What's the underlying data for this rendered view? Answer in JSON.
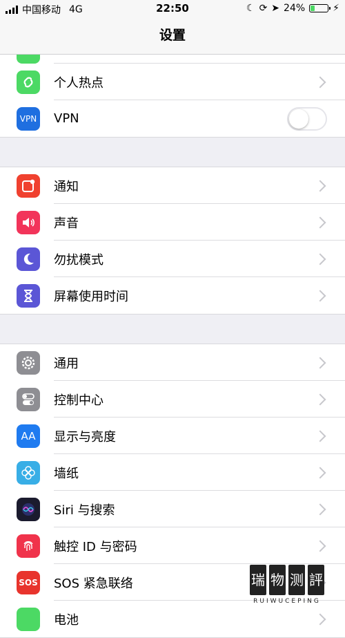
{
  "status": {
    "carrier": "中国移动",
    "network": "4G",
    "time": "22:50",
    "battery": "24%",
    "battery_level": 0.24
  },
  "nav": {
    "title": "设置"
  },
  "groups": [
    {
      "items": [
        {
          "label": "个人热点",
          "icon": "hotspot-icon",
          "color": "#4cd964"
        },
        {
          "label": "VPN",
          "icon": "vpn-icon",
          "color": "#1f6fe0",
          "toggle": false,
          "icon_text": "VPN"
        }
      ]
    },
    {
      "items": [
        {
          "label": "通知",
          "icon": "notifications-icon",
          "color": "#f0412f"
        },
        {
          "label": "声音",
          "icon": "sound-icon",
          "color": "#f2345a"
        },
        {
          "label": "勿扰模式",
          "icon": "moon-icon",
          "color": "#5b56d6"
        },
        {
          "label": "屏幕使用时间",
          "icon": "hourglass-icon",
          "color": "#5b56d6"
        }
      ]
    },
    {
      "items": [
        {
          "label": "通用",
          "icon": "gear-icon",
          "color": "#8e8e93"
        },
        {
          "label": "控制中心",
          "icon": "toggles-icon",
          "color": "#8e8e93"
        },
        {
          "label": "显示与亮度",
          "icon": "display-icon",
          "color": "#1f7bf0",
          "icon_text": "AA"
        },
        {
          "label": "墙纸",
          "icon": "wallpaper-icon",
          "color": "#38aee6"
        },
        {
          "label": "Siri 与搜索",
          "icon": "siri-icon",
          "color": "#1b1b2e"
        },
        {
          "label": "触控 ID 与密码",
          "icon": "fingerprint-icon",
          "color": "#f0334b"
        },
        {
          "label": "SOS 紧急联络",
          "icon": "sos-icon",
          "color": "#e8342d",
          "icon_text": "SOS"
        },
        {
          "label": "电池",
          "icon": "battery-setting-icon",
          "color": "#4cd964"
        }
      ]
    }
  ],
  "watermark": {
    "chars": [
      "瑞",
      "物",
      "测",
      "評"
    ],
    "sub": "RUIWUCEPING"
  }
}
